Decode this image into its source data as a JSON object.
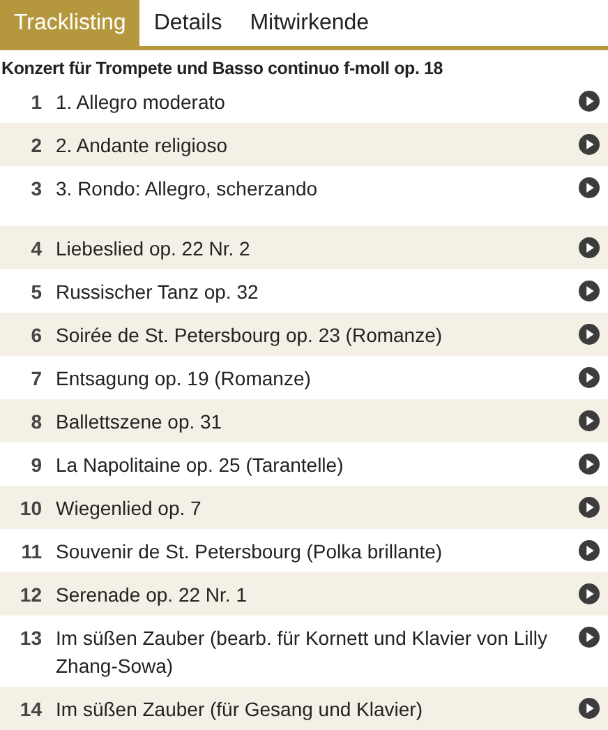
{
  "tabs": [
    {
      "label": "Tracklisting",
      "selected": true
    },
    {
      "label": "Details",
      "selected": false
    },
    {
      "label": "Mitwirkende",
      "selected": false
    }
  ],
  "sections": [
    {
      "kind": "work",
      "title": "Konzert für Trompete und Basso continuo f-moll op. 18",
      "tracks": [
        {
          "number": "1",
          "title": "1. Allegro moderato"
        },
        {
          "number": "2",
          "title": "2. Andante religioso"
        },
        {
          "number": "3",
          "title": "3. Rondo: Allegro, scherzando"
        }
      ]
    },
    {
      "kind": "single",
      "tracks": [
        {
          "number": "4",
          "title": "Liebeslied op. 22 Nr. 2"
        },
        {
          "number": "5",
          "title": "Russischer Tanz op. 32"
        },
        {
          "number": "6",
          "title": "Soirée de St. Petersbourg op. 23 (Romanze)"
        },
        {
          "number": "7",
          "title": "Entsagung op. 19 (Romanze)"
        },
        {
          "number": "8",
          "title": "Ballettszene op. 31"
        },
        {
          "number": "9",
          "title": "La Napolitaine op. 25 (Tarantelle)"
        },
        {
          "number": "10",
          "title": "Wiegenlied op. 7"
        },
        {
          "number": "11",
          "title": "Souvenir de St. Petersbourg (Polka brillante)"
        },
        {
          "number": "12",
          "title": "Serenade op. 22 Nr. 1"
        },
        {
          "number": "13",
          "title": "Im süßen Zauber (bearb. für Kornett und Klavier von Lilly Zhang-Sowa)"
        },
        {
          "number": "14",
          "title": "Im süßen Zauber (für Gesang und Klavier)"
        }
      ]
    }
  ]
}
